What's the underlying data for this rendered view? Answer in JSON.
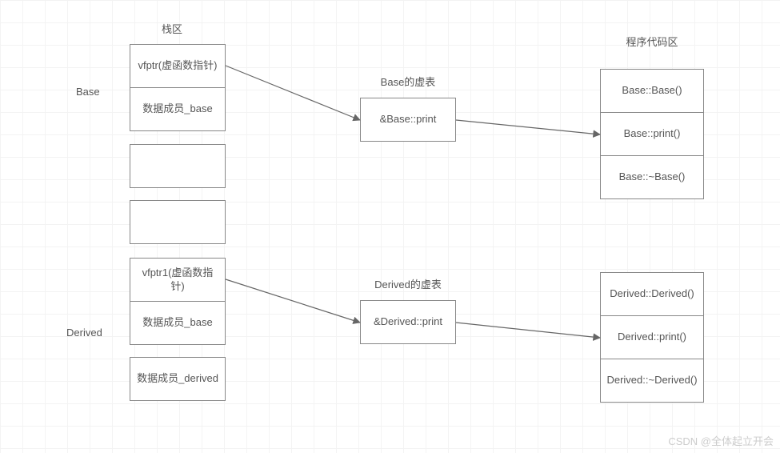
{
  "headers": {
    "stack": "栈区",
    "code": "程序代码区",
    "base_vtable": "Base的虚表",
    "derived_vtable": "Derived的虚表"
  },
  "side_labels": {
    "base": "Base",
    "derived": "Derived"
  },
  "stack": {
    "base_vfptr": "vfptr(虚函数指针)",
    "base_member": "数据成员_base",
    "derived_vfptr": "vfptr1(虚函数指针)",
    "derived_member1": "数据成员_base",
    "derived_member2": "数据成员_derived"
  },
  "vtables": {
    "base": "&Base::print",
    "derived": "&Derived::print"
  },
  "code": {
    "base_ctor": "Base::Base()",
    "base_print": "Base::print()",
    "base_dtor": "Base::~Base()",
    "derived_ctor": "Derived::Derived()",
    "derived_print": "Derived::print()",
    "derived_dtor": "Derived::~Derived()"
  },
  "watermark": "CSDN @全体起立开会"
}
